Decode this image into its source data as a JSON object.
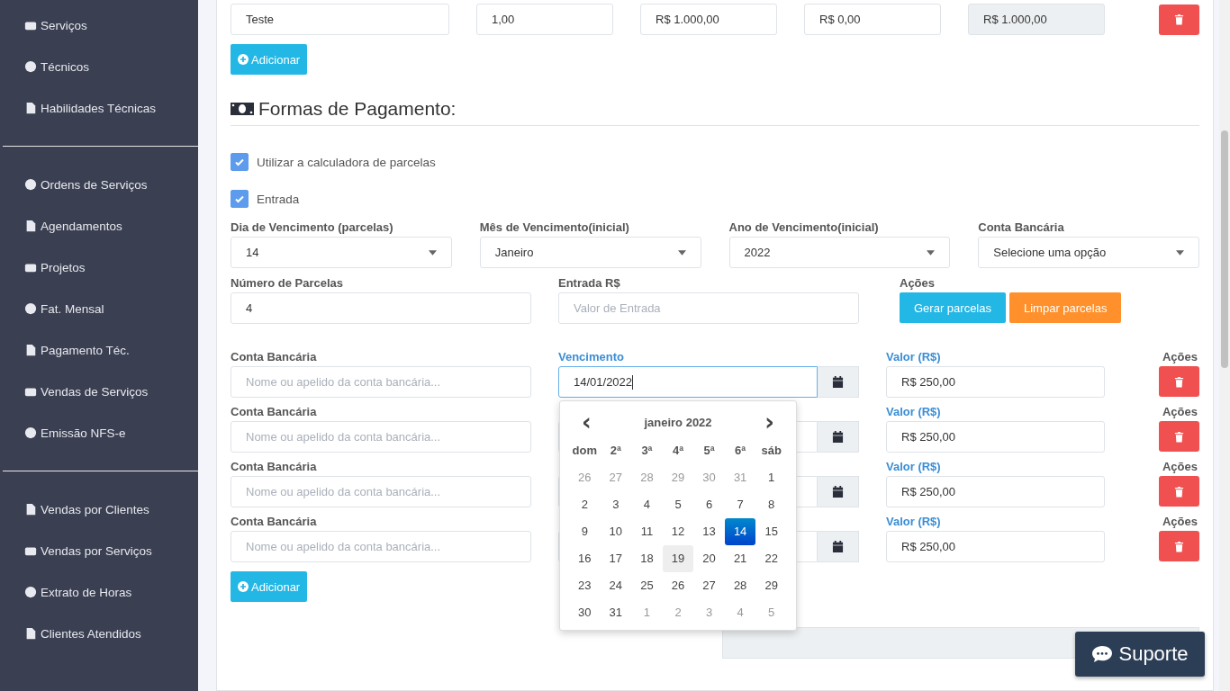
{
  "sidebar": {
    "groups": [
      {
        "items": [
          {
            "label": "Serviços"
          },
          {
            "label": "Técnicos"
          },
          {
            "label": "Habilidades Técnicas"
          }
        ]
      },
      {
        "items": [
          {
            "label": "Ordens de Serviços"
          },
          {
            "label": "Agendamentos"
          },
          {
            "label": "Projetos"
          },
          {
            "label": "Fat. Mensal"
          },
          {
            "label": "Pagamento Téc."
          },
          {
            "label": "Vendas de Serviços"
          },
          {
            "label": "Emissão NFS-e"
          }
        ]
      },
      {
        "items": [
          {
            "label": "Vendas por Clientes"
          },
          {
            "label": "Vendas por Serviços"
          },
          {
            "label": "Extrato de Horas"
          },
          {
            "label": "Clientes Atendidos"
          }
        ]
      }
    ]
  },
  "item_row": {
    "description": "Teste",
    "quantity": "1,00",
    "price": "R$ 1.000,00",
    "discount": "R$ 0,00",
    "total": "R$ 1.000,00"
  },
  "add_item_button": "Adicionar",
  "payment": {
    "title": "Formas de Pagamento:",
    "checkboxes": [
      {
        "label": "Utilizar a calculadora de parcelas",
        "checked": true
      },
      {
        "label": "Entrada",
        "checked": true
      }
    ],
    "selects": [
      {
        "label": "Dia de Vencimento (parcelas)",
        "value": "14"
      },
      {
        "label": "Mês de Vencimento(inicial)",
        "value": "Janeiro"
      },
      {
        "label": "Ano de Vencimento(inicial)",
        "value": "2022"
      },
      {
        "label": "Conta Bancária",
        "value": "Selecione uma opção"
      }
    ],
    "installments_count": {
      "label": "Número de Parcelas",
      "value": "4"
    },
    "down_payment": {
      "label": "Entrada R$",
      "placeholder": "Valor de Entrada"
    },
    "actions": {
      "label": "Ações",
      "generate": "Gerar parcelas",
      "clear": "Limpar parcelas"
    },
    "installments": [
      {
        "account_label": "Conta Bancária",
        "account_placeholder": "Nome ou apelido da conta bancária...",
        "due_label": "Vencimento",
        "due_value": "14/01/2022",
        "value_label": "Valor (R$)",
        "value": "R$ 250,00",
        "actions_label": "Ações"
      },
      {
        "account_label": "Conta Bancária",
        "account_placeholder": "Nome ou apelido da conta bancária...",
        "value_label": "Valor (R$)",
        "value": "R$ 250,00",
        "actions_label": "Ações"
      },
      {
        "account_label": "Conta Bancária",
        "account_placeholder": "Nome ou apelido da conta bancária...",
        "value_label": "Valor (R$)",
        "value": "R$ 250,00",
        "actions_label": "Ações"
      },
      {
        "account_label": "Conta Bancária",
        "account_placeholder": "Nome ou apelido da conta bancária...",
        "value_label": "Valor (R$)",
        "value": "R$ 250,00",
        "actions_label": "Ações"
      }
    ],
    "add_button": "Adicionar"
  },
  "datepicker": {
    "prev": "‹",
    "next": "›",
    "month": "janeiro 2022",
    "weekdays": [
      "dom",
      "2ª",
      "3ª",
      "4ª",
      "5ª",
      "6ª",
      "sáb"
    ],
    "weeks": [
      [
        {
          "d": "26",
          "outside": true,
          "selected": false,
          "hovered": false
        },
        {
          "d": "27",
          "outside": true,
          "selected": false,
          "hovered": false
        },
        {
          "d": "28",
          "outside": true,
          "selected": false,
          "hovered": false
        },
        {
          "d": "29",
          "outside": true,
          "selected": false,
          "hovered": false
        },
        {
          "d": "30",
          "outside": true,
          "selected": false,
          "hovered": false
        },
        {
          "d": "31",
          "outside": true,
          "selected": false,
          "hovered": false
        },
        {
          "d": "1",
          "outside": false,
          "selected": false,
          "hovered": false
        }
      ],
      [
        {
          "d": "2",
          "outside": false,
          "selected": false,
          "hovered": false
        },
        {
          "d": "3",
          "outside": false,
          "selected": false,
          "hovered": false
        },
        {
          "d": "4",
          "outside": false,
          "selected": false,
          "hovered": false
        },
        {
          "d": "5",
          "outside": false,
          "selected": false,
          "hovered": false
        },
        {
          "d": "6",
          "outside": false,
          "selected": false,
          "hovered": false
        },
        {
          "d": "7",
          "outside": false,
          "selected": false,
          "hovered": false
        },
        {
          "d": "8",
          "outside": false,
          "selected": false,
          "hovered": false
        }
      ],
      [
        {
          "d": "9",
          "outside": false,
          "selected": false,
          "hovered": false
        },
        {
          "d": "10",
          "outside": false,
          "selected": false,
          "hovered": false
        },
        {
          "d": "11",
          "outside": false,
          "selected": false,
          "hovered": false
        },
        {
          "d": "12",
          "outside": false,
          "selected": false,
          "hovered": false
        },
        {
          "d": "13",
          "outside": false,
          "selected": false,
          "hovered": false
        },
        {
          "d": "14",
          "outside": false,
          "selected": true,
          "hovered": false
        },
        {
          "d": "15",
          "outside": false,
          "selected": false,
          "hovered": false
        }
      ],
      [
        {
          "d": "16",
          "outside": false,
          "selected": false,
          "hovered": false
        },
        {
          "d": "17",
          "outside": false,
          "selected": false,
          "hovered": false
        },
        {
          "d": "18",
          "outside": false,
          "selected": false,
          "hovered": false
        },
        {
          "d": "19",
          "outside": false,
          "selected": false,
          "hovered": true
        },
        {
          "d": "20",
          "outside": false,
          "selected": false,
          "hovered": false
        },
        {
          "d": "21",
          "outside": false,
          "selected": false,
          "hovered": false
        },
        {
          "d": "22",
          "outside": false,
          "selected": false,
          "hovered": false
        }
      ],
      [
        {
          "d": "23",
          "outside": false,
          "selected": false,
          "hovered": false
        },
        {
          "d": "24",
          "outside": false,
          "selected": false,
          "hovered": false
        },
        {
          "d": "25",
          "outside": false,
          "selected": false,
          "hovered": false
        },
        {
          "d": "26",
          "outside": false,
          "selected": false,
          "hovered": false
        },
        {
          "d": "27",
          "outside": false,
          "selected": false,
          "hovered": false
        },
        {
          "d": "28",
          "outside": false,
          "selected": false,
          "hovered": false
        },
        {
          "d": "29",
          "outside": false,
          "selected": false,
          "hovered": false
        }
      ],
      [
        {
          "d": "30",
          "outside": false,
          "selected": false,
          "hovered": false
        },
        {
          "d": "31",
          "outside": false,
          "selected": false,
          "hovered": false
        },
        {
          "d": "1",
          "outside": true,
          "selected": false,
          "hovered": false
        },
        {
          "d": "2",
          "outside": true,
          "selected": false,
          "hovered": false
        },
        {
          "d": "3",
          "outside": true,
          "selected": false,
          "hovered": false
        },
        {
          "d": "4",
          "outside": true,
          "selected": false,
          "hovered": false
        },
        {
          "d": "5",
          "outside": true,
          "selected": false,
          "hovered": false
        }
      ]
    ]
  },
  "support_button": "Suporte"
}
